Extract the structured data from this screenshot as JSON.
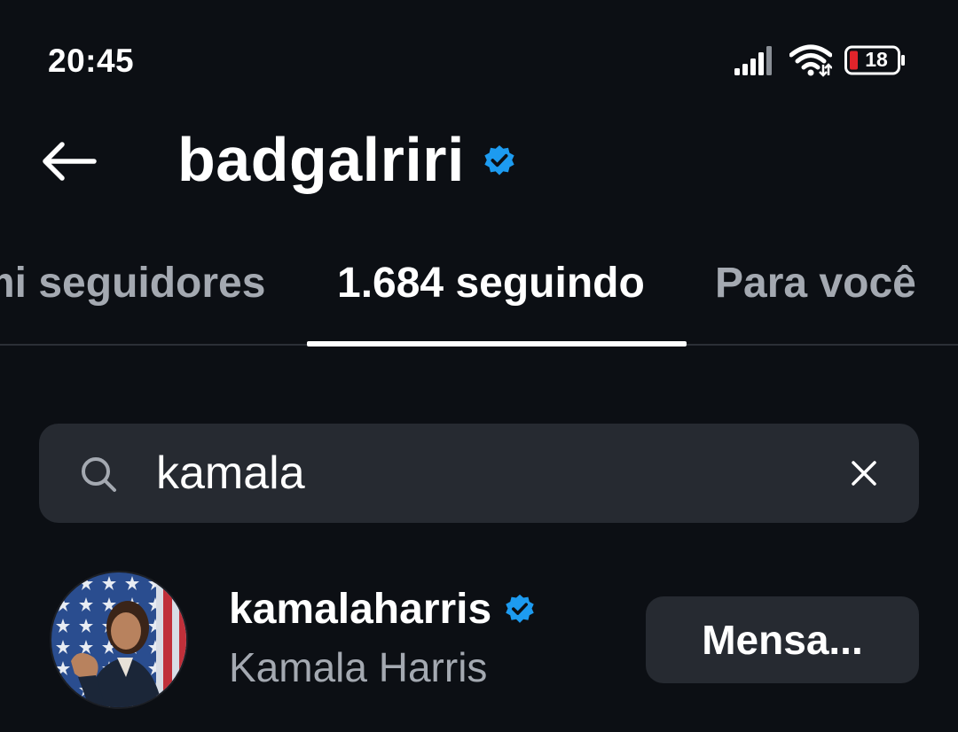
{
  "status_bar": {
    "time": "20:45",
    "battery_level": "18",
    "icons": [
      "signal-icon",
      "wifi-icon",
      "battery-icon"
    ],
    "battery_color": "#e0242b"
  },
  "header": {
    "title": "badgalriri",
    "verified": true,
    "back_icon": "arrow-left-icon"
  },
  "tabs": [
    {
      "label": "mi seguidores",
      "active": false
    },
    {
      "label": "1.684 seguindo",
      "active": true
    },
    {
      "label": "Para você",
      "active": false
    }
  ],
  "search": {
    "value": "kamala",
    "icon": "search-icon",
    "clear_icon": "close-icon"
  },
  "results": [
    {
      "username": "kamalaharris",
      "full_name": "Kamala Harris",
      "verified": true,
      "action_label": "Mensa..."
    }
  ],
  "colors": {
    "background": "#0c0f14",
    "surface": "#262a31",
    "verified_blue": "#1d9bf0",
    "secondary_text": "#a4a9b1"
  }
}
